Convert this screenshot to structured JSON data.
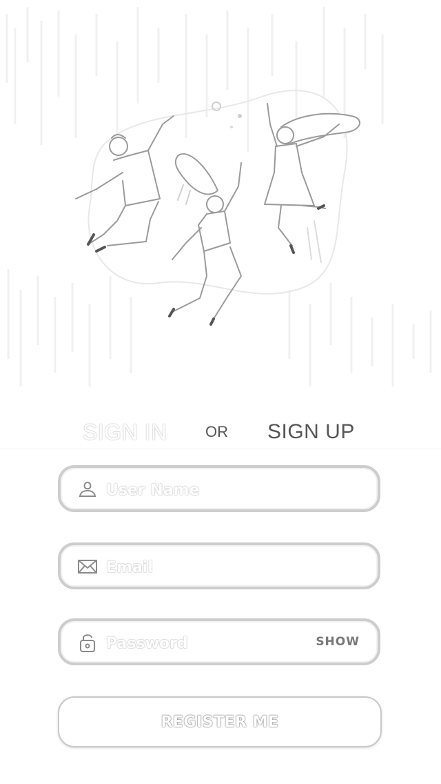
{
  "tabs": {
    "sign_in": "SIGN IN",
    "or": "OR",
    "sign_up": "SIGN UP"
  },
  "form": {
    "username": {
      "placeholder": "User Name",
      "value": "",
      "icon": "user-icon"
    },
    "email": {
      "placeholder": "Email",
      "value": "",
      "icon": "mail-icon"
    },
    "password": {
      "placeholder": "Password",
      "value": "",
      "icon": "padlock-icon",
      "toggle_label": "SHOW"
    },
    "submit_label": "REGISTER ME"
  },
  "hero": {
    "icon": "people-jumping-illustration"
  },
  "colors": {
    "field_border": "#cdcdcd",
    "text": "#555555",
    "background": "#ffffff"
  }
}
